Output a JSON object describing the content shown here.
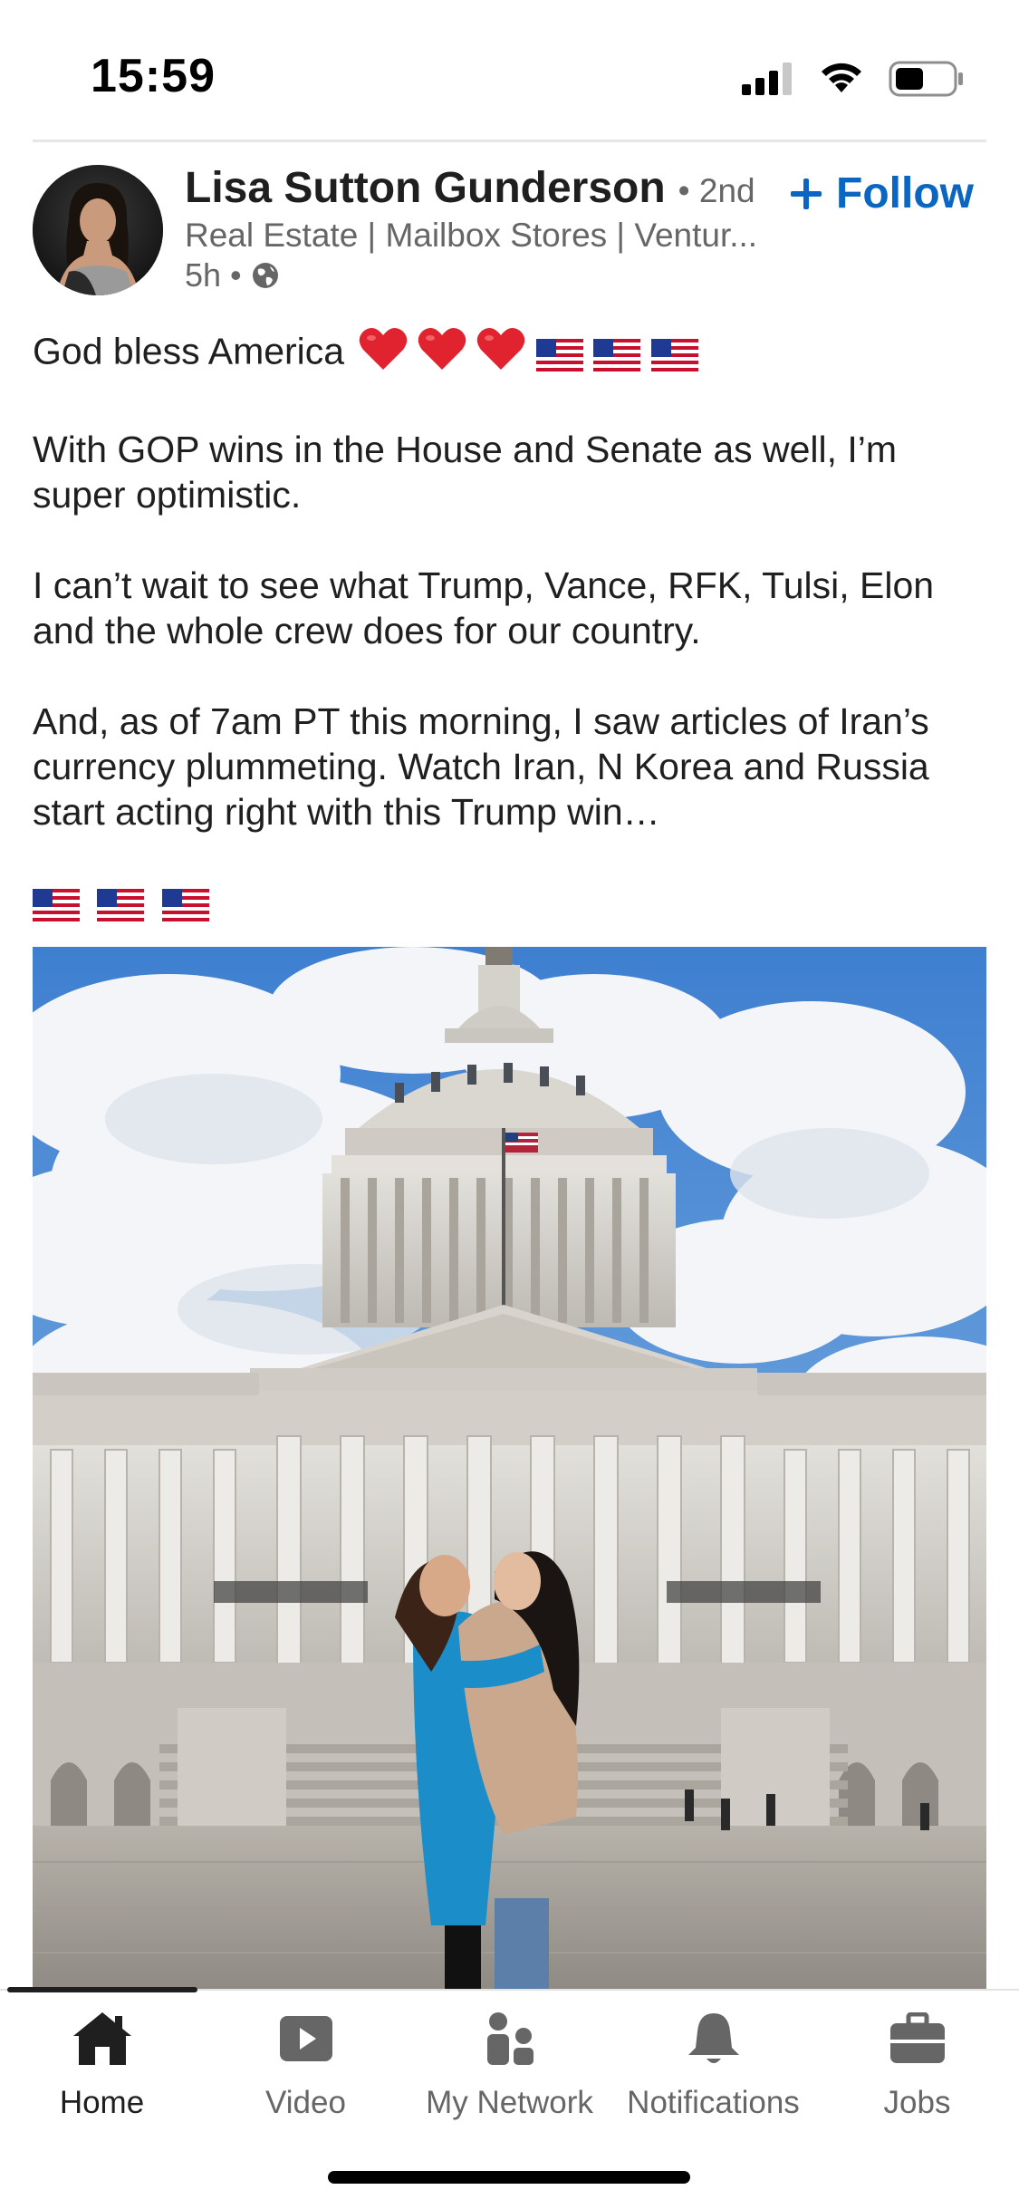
{
  "status_bar": {
    "time": "15:59"
  },
  "post": {
    "author": {
      "name": "Lisa Sutton Gunderson",
      "degree": "• 2nd",
      "headline": "Real Estate | Mailbox Stores | Ventur...",
      "time_ago": "5h",
      "meta_separator": "•",
      "visibility_icon": "globe-icon"
    },
    "follow_label": "Follow",
    "text": {
      "line1": "God bless America",
      "line1_emoji": [
        "heart",
        "heart",
        "heart",
        "us-flag",
        "us-flag",
        "us-flag"
      ],
      "para2": "With GOP wins in the House and Senate as well, I’m super optimistic.",
      "para3": "I can’t wait to see what Trump, Vance, RFK, Tulsi, Elon and the whole crew does for our country.",
      "para4": "And, as of 7am PT this morning, I saw articles of Iran’s currency plummeting. Watch Iran, N Korea and Russia start acting right with this Trump win…",
      "flags_line": [
        "us-flag",
        "us-flag",
        "us-flag"
      ]
    },
    "image": {
      "subject": "us-capitol-photo"
    }
  },
  "bottom_nav": {
    "items": [
      {
        "label": "Home",
        "icon": "home-icon",
        "active": true
      },
      {
        "label": "Video",
        "icon": "video-icon",
        "active": false
      },
      {
        "label": "My Network",
        "icon": "network-icon",
        "active": false
      },
      {
        "label": "Notifications",
        "icon": "bell-icon",
        "active": false
      },
      {
        "label": "Jobs",
        "icon": "briefcase-icon",
        "active": false
      }
    ]
  },
  "colors": {
    "linkedin_blue": "#0a66c2",
    "text_primary": "#1f1f1f",
    "text_secondary": "#666666",
    "heart_red": "#e0232e"
  }
}
